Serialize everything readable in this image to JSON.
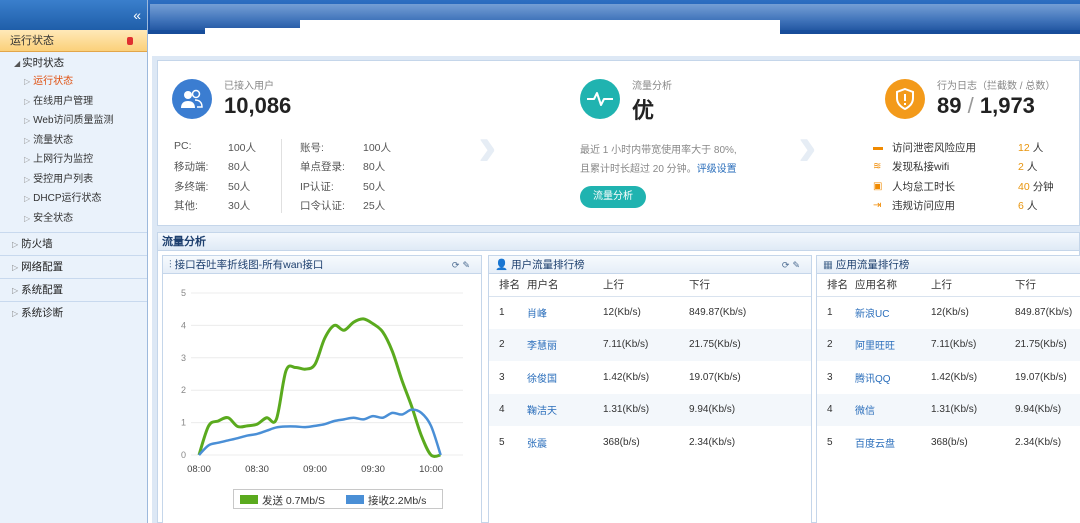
{
  "sidebar": {
    "collapse_glyph": "«",
    "active_label": "运行状态",
    "group_label": "实时状态",
    "items": [
      {
        "label": "运行状态",
        "current": true
      },
      {
        "label": "在线用户管理"
      },
      {
        "label": "Web访问质量监测"
      },
      {
        "label": "流量状态"
      },
      {
        "label": "上网行为监控"
      },
      {
        "label": "受控用户列表"
      },
      {
        "label": "DHCP运行状态"
      },
      {
        "label": "安全状态"
      }
    ],
    "top_items": [
      "防火墙",
      "网络配置",
      "系统配置",
      "系统诊断"
    ]
  },
  "users_card": {
    "label": "已接入用户",
    "value": "10,086",
    "left": [
      {
        "k": "PC:",
        "v": "100人"
      },
      {
        "k": "移动端:",
        "v": "80人"
      },
      {
        "k": "多终端:",
        "v": "50人"
      },
      {
        "k": "其他:",
        "v": "30人"
      }
    ],
    "right": [
      {
        "k": "账号:",
        "v": "100人"
      },
      {
        "k": "单点登录:",
        "v": "80人"
      },
      {
        "k": "IP认证:",
        "v": "50人"
      },
      {
        "k": "口令认证:",
        "v": "25人"
      }
    ]
  },
  "flow_card": {
    "label": "流量分析",
    "value": "优",
    "note1": "最近 1 小时内带宽使用率大于 80%,",
    "note2": "且累计时长超过 20 分钟。",
    "note_link": "评级设置",
    "button": "流量分析"
  },
  "log_card": {
    "label": "行为日志（拦截数 / 总数）",
    "value_left": "89",
    "value_sep": "/",
    "value_right": "1,973",
    "rows": [
      {
        "label": "访问泄密风险应用",
        "value": "12",
        "unit": "人"
      },
      {
        "label": "发现私接wifi",
        "value": "2",
        "unit": "人"
      },
      {
        "label": "人均怠工时长",
        "value": "40",
        "unit": "分钟"
      },
      {
        "label": "违规访问应用",
        "value": "6",
        "unit": "人"
      }
    ]
  },
  "section": {
    "title": "流量分析"
  },
  "chart_panel": {
    "title": "接口吞吐率折线图-所有wan接口",
    "legend_send": "发送 0.7Mb/S",
    "legend_recv": "接收2.2Mb/s"
  },
  "user_rank": {
    "title": "用户流量排行榜",
    "headers": [
      "排名",
      "用户名",
      "上行",
      "下行"
    ],
    "rows": [
      [
        "1",
        "肖峰",
        "12(Kb/s)",
        "849.87(Kb/s)"
      ],
      [
        "2",
        "李慧丽",
        "7.11(Kb/s)",
        "21.75(Kb/s)"
      ],
      [
        "3",
        "徐俊国",
        "1.42(Kb/s)",
        "19.07(Kb/s)"
      ],
      [
        "4",
        "鞠洁天",
        "1.31(Kb/s)",
        "9.94(Kb/s)"
      ],
      [
        "5",
        "张震",
        "368(b/s)",
        "2.34(Kb/s)"
      ]
    ]
  },
  "app_rank": {
    "title": "应用流量排行榜",
    "headers": [
      "排名",
      "应用名称",
      "上行",
      "下行"
    ],
    "rows": [
      [
        "1",
        "新浪UC",
        "12(Kb/s)",
        "849.87(Kb/s)"
      ],
      [
        "2",
        "阿里旺旺",
        "7.11(Kb/s)",
        "21.75(Kb/s)"
      ],
      [
        "3",
        "腾讯QQ",
        "1.42(Kb/s)",
        "19.07(Kb/s)"
      ],
      [
        "4",
        "微信",
        "1.31(Kb/s)",
        "9.94(Kb/s)"
      ],
      [
        "5",
        "百度云盘",
        "368(b/s)",
        "2.34(Kb/s)"
      ]
    ]
  },
  "chart_data": {
    "type": "line",
    "title": "接口吞吐率折线图-所有wan接口",
    "x_ticks": [
      "08:00",
      "08:30",
      "09:00",
      "09:30",
      "10:00"
    ],
    "y_ticks": [
      "0",
      "1",
      "2",
      "3",
      "4",
      "5"
    ],
    "ylim": [
      0,
      5
    ],
    "x": [
      "08:00",
      "08:05",
      "08:10",
      "08:15",
      "08:20",
      "08:25",
      "08:30",
      "08:35",
      "08:40",
      "08:45",
      "08:50",
      "08:55",
      "09:00",
      "09:05",
      "09:10",
      "09:15",
      "09:20",
      "09:25",
      "09:30",
      "09:35",
      "09:40",
      "09:45",
      "09:50",
      "09:55",
      "10:00",
      "10:05"
    ],
    "series": [
      {
        "name": "发送 0.7Mb/S",
        "color": "#5aaa1e",
        "values": [
          0.0,
          0.9,
          1.05,
          1.15,
          0.88,
          0.9,
          0.95,
          1.15,
          1.1,
          2.6,
          2.7,
          2.65,
          2.8,
          3.6,
          4.0,
          3.85,
          4.1,
          4.2,
          4.05,
          3.8,
          3.2,
          2.3,
          1.5,
          0.6,
          0.0,
          0.0
        ]
      },
      {
        "name": "接收2.2Mb/s",
        "color": "#4a8fd6",
        "values": [
          0.0,
          0.3,
          0.38,
          0.45,
          0.52,
          0.6,
          0.65,
          0.75,
          0.85,
          0.88,
          0.88,
          0.86,
          0.9,
          0.95,
          1.05,
          1.1,
          1.15,
          1.1,
          1.2,
          1.15,
          1.3,
          1.25,
          1.4,
          1.3,
          0.9,
          0.0
        ]
      }
    ],
    "grid": true,
    "legend": "bottom"
  }
}
